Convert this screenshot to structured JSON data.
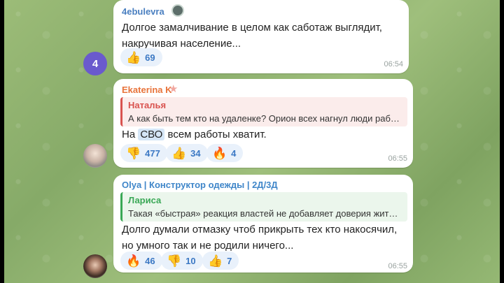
{
  "messages": [
    {
      "sender": "4ebulevra",
      "sender_color": "#4a7fc0",
      "text_lines": [
        "Долгое замалчивание в целом как саботаж выглядит,",
        "накручивая население..."
      ],
      "reactions": [
        {
          "icon": "thumbs-up-icon",
          "glyph": "👍",
          "count": "69"
        }
      ],
      "time": "06:54",
      "avatar_label": "4",
      "avatar_color": "#6a5acd"
    },
    {
      "sender": "Ekaterina K",
      "sender_color": "#e8733a",
      "quote": {
        "name": "Наталья",
        "text": "А как быть тем кто на удаленке? Орион всех нагнул люди работ...",
        "color": "#d9534f",
        "bg": "#fbeceb"
      },
      "text_before": "На ",
      "text_highlight": "СВО",
      "text_after": " всем работы хватит.",
      "reactions": [
        {
          "icon": "thumbs-down-icon",
          "glyph": "👎",
          "count": "477"
        },
        {
          "icon": "thumbs-up-icon",
          "glyph": "👍",
          "count": "34"
        },
        {
          "icon": "fire-icon",
          "glyph": "🔥",
          "count": "4"
        }
      ],
      "time": "06:55"
    },
    {
      "sender": "Olya | Конструктор одежды | 2Д/3Д",
      "sender_color": "#3f86c9",
      "quote": {
        "name": "Лариса",
        "text": "Такая «быстрая» реакция властей не добавляет доверия жител...",
        "color": "#3aa856",
        "bg": "#ebf6ec"
      },
      "text_lines": [
        "Долго думали отмазку чтоб прикрыть тех кто накосячил,",
        "но умного так и не родили ничего..."
      ],
      "reactions": [
        {
          "icon": "fire-icon",
          "glyph": "🔥",
          "count": "46"
        },
        {
          "icon": "thumbs-down-icon",
          "glyph": "👎",
          "count": "10"
        },
        {
          "icon": "thumbs-up-icon",
          "glyph": "👍",
          "count": "7"
        }
      ],
      "time": "06:55"
    }
  ]
}
